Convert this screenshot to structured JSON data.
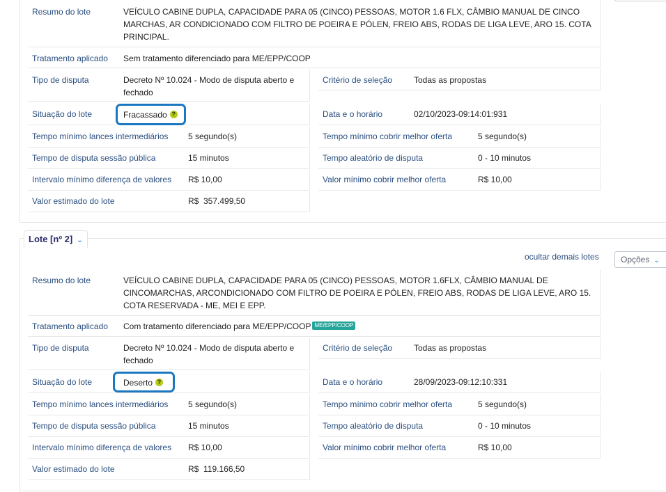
{
  "top_panel": {
    "resumo_label": "Resumo do lote",
    "resumo_value": "VEÍCULO CABINE DUPLA, CAPACIDADE PARA 05 (CINCO) PESSOAS, MOTOR 1.6 FLX, CÂMBIO MANUAL DE CINCO MARCHAS, AR CONDICIONADO COM FILTRO DE POEIRA E PÓLEN, FREIO ABS, RODAS DE LIGA LEVE, ARO 15. COTA PRINCIPAL.",
    "tratamento_label": "Tratamento aplicado",
    "tratamento_value": "Sem tratamento diferenciado para ME/EPP/COOP",
    "tipo_label": "Tipo de disputa",
    "tipo_value": "Decreto Nº 10.024 - Modo de disputa aberto e fechado",
    "criterio_label": "Critério de seleção",
    "criterio_value": "Todas as propostas",
    "situacao_label": "Situação do lote",
    "situacao_value": "Fracassado",
    "data_label": "Data e o horário",
    "data_value": "02/10/2023-09:14:01:931",
    "tempo_lances_label": "Tempo mínimo lances intermediários",
    "tempo_lances_value": "5 segundo(s)",
    "tempo_cobrir_label": "Tempo mínimo cobrir melhor oferta",
    "tempo_cobrir_value": "5 segundo(s)",
    "tempo_sessao_label": "Tempo de disputa sessão pública",
    "tempo_sessao_value": "15 minutos",
    "tempo_aleatorio_label": "Tempo aleatório de disputa",
    "tempo_aleatorio_value": "0 - 10 minutos",
    "intervalo_label": "Intervalo mínimo diferença de valores",
    "intervalo_value": "R$ 10,00",
    "valor_cobrir_label": "Valor mínimo cobrir melhor oferta",
    "valor_cobrir_value": "R$ 10,00",
    "valor_estimado_label": "Valor estimado do lote",
    "valor_estimado_value": "R$  357.499,50"
  },
  "lote2": {
    "tab_label": "Lote [nº 2]",
    "ocultar_link": "ocultar demais lotes",
    "opcoes_button": "Opções",
    "resumo_label": "Resumo do lote",
    "resumo_value": "VEÍCULO CABINE DUPLA, CAPACIDADE PARA 05 (CINCO) PESSOAS, MOTOR 1.6FLX, CÂMBIO MANUAL DE CINCOMARCHAS, ARCONDICIONADO COM FILTRO DE POEIRA E PÓLEN, FREIO ABS, RODAS DE LIGA LEVE, ARO 15. COTA RESERVADA - ME, MEI E EPP.",
    "tratamento_label": "Tratamento aplicado",
    "tratamento_value": "Com tratamento diferenciado para ME/EPP/COOP",
    "tratamento_tag": "ME/EPP/COOP",
    "tipo_label": "Tipo de disputa",
    "tipo_value": "Decreto Nº 10.024 - Modo de disputa aberto e fechado",
    "criterio_label": "Critério de seleção",
    "criterio_value": "Todas as propostas",
    "situacao_label": "Situação do lote",
    "situacao_value": "Deserto",
    "data_label": "Data e o horário",
    "data_value": "28/09/2023-09:12:10:331",
    "tempo_lances_label": "Tempo mínimo lances intermediários",
    "tempo_lances_value": "5 segundo(s)",
    "tempo_cobrir_label": "Tempo mínimo cobrir melhor oferta",
    "tempo_cobrir_value": "5 segundo(s)",
    "tempo_sessao_label": "Tempo de disputa sessão pública",
    "tempo_sessao_value": "15 minutos",
    "tempo_aleatorio_label": "Tempo aleatório de disputa",
    "tempo_aleatorio_value": "0 - 10 minutos",
    "intervalo_label": "Intervalo mínimo diferença de valores",
    "intervalo_value": "R$ 10,00",
    "valor_cobrir_label": "Valor mínimo cobrir melhor oferta",
    "valor_cobrir_value": "R$ 10,00",
    "valor_estimado_label": "Valor estimado do lote",
    "valor_estimado_value": "R$  119.166,50"
  },
  "help_glyph": "?",
  "colors": {
    "label": "#2a4e7f",
    "highlight": "#1a78c2",
    "tag": "#26a69a",
    "help": "#b5c91a"
  }
}
